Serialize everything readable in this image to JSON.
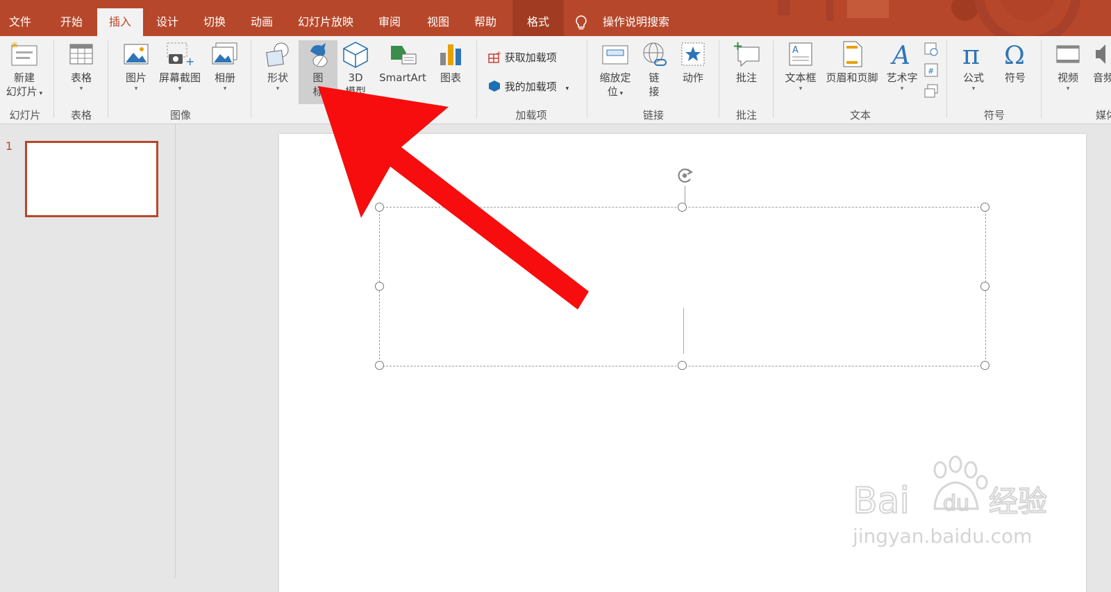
{
  "tabs": [
    {
      "label": "文件",
      "state": "normal"
    },
    {
      "label": "开始",
      "state": "normal"
    },
    {
      "label": "插入",
      "state": "active"
    },
    {
      "label": "设计",
      "state": "normal"
    },
    {
      "label": "切换",
      "state": "normal"
    },
    {
      "label": "动画",
      "state": "normal"
    },
    {
      "label": "幻灯片放映",
      "state": "normal"
    },
    {
      "label": "审阅",
      "state": "normal"
    },
    {
      "label": "视图",
      "state": "normal"
    },
    {
      "label": "帮助",
      "state": "normal"
    },
    {
      "label": "格式",
      "state": "contextual"
    }
  ],
  "search": {
    "label": "操作说明搜索",
    "icon": "lightbulb-icon"
  },
  "ribbon": {
    "new_slide": {
      "line1": "新建",
      "line2": "幻灯片"
    },
    "table": "表格",
    "picture": "图片",
    "screenshot": "屏幕截图",
    "album": "相册",
    "shapes": "形状",
    "icons_line1": "图",
    "icons_line2": "标",
    "model_line1": "3D",
    "model_line2": "模型",
    "smartart": "SmartArt",
    "chart": "图表",
    "get_addins": "获取加载项",
    "my_addins": "我的加载项",
    "zoom_line1": "缩放定",
    "zoom_line2": "位",
    "link_line1": "链",
    "link_line2": "接",
    "action": "动作",
    "comment": "批注",
    "textbox": "文本框",
    "header_footer": "页眉和页脚",
    "wordart": "艺术字",
    "equation": "公式",
    "symbol": "符号",
    "video": "视频",
    "audio": "音频"
  },
  "groups": {
    "slides": "幻灯片",
    "tables": "表格",
    "images": "图像",
    "addins": "加载项",
    "links": "链接",
    "comments": "批注",
    "text": "文本",
    "symbols": "符号",
    "media": "媒体"
  },
  "thumbnails": {
    "slide_number": "1"
  },
  "watermark": {
    "text": "jingyan.baidu.com"
  },
  "colors": {
    "accent": "#b7472a",
    "arrow": "#ff0000",
    "ribbon_bg": "#f2f2f2"
  }
}
